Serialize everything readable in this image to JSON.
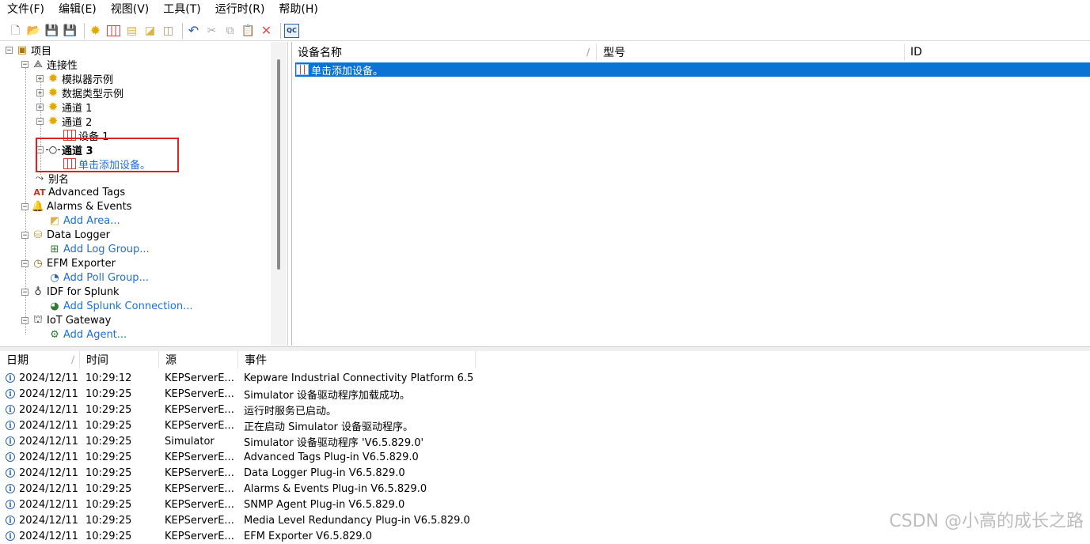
{
  "menu": [
    "文件(F)",
    "编辑(E)",
    "视图(V)",
    "工具(T)",
    "运行时(R)",
    "帮助(H)"
  ],
  "toolbar": {
    "icons": [
      "new-icon",
      "open-icon",
      "save-icon",
      "save-as-icon",
      "new-channel-icon",
      "new-device-icon",
      "new-group-icon",
      "new-tag-icon",
      "bulk-tag-icon",
      "undo-icon",
      "cut-icon",
      "copy-icon",
      "paste-icon",
      "delete-icon",
      "quick-client-icon"
    ],
    "qc_label": "QC"
  },
  "tree": {
    "project": "项目",
    "connectivity": "连接性",
    "sim_example": "模拟器示例",
    "datatype_example": "数据类型示例",
    "channel1": "通道 1",
    "channel2": "通道 2",
    "device1": "设备 1",
    "channel3": "通道 3",
    "add_device": "单击添加设备。",
    "alias": "别名",
    "advanced_tags": "Advanced Tags",
    "alarms_events": "Alarms & Events",
    "add_area": "Add Area...",
    "data_logger": "Data Logger",
    "add_log_group": "Add Log Group...",
    "efm_exporter": "EFM Exporter",
    "add_poll_group": "Add Poll Group...",
    "idf_splunk": "IDF for Splunk",
    "add_splunk": "Add Splunk Connection...",
    "iot_gateway": "IoT Gateway",
    "add_agent": "Add Agent..."
  },
  "devices": {
    "headers": [
      "设备名称",
      "型号",
      "ID"
    ],
    "selected_row": "单击添加设备。"
  },
  "log": {
    "headers": [
      "日期",
      "时间",
      "源",
      "事件"
    ],
    "rows": [
      {
        "date": "2024/12/11",
        "time": "10:29:12",
        "source": "KEPServerE...",
        "event": "Kepware Industrial Connectivity Platform 6.5"
      },
      {
        "date": "2024/12/11",
        "time": "10:29:25",
        "source": "KEPServerE...",
        "event": "Simulator 设备驱动程序加载成功。"
      },
      {
        "date": "2024/12/11",
        "time": "10:29:25",
        "source": "KEPServerE...",
        "event": "运行时服务已启动。"
      },
      {
        "date": "2024/12/11",
        "time": "10:29:25",
        "source": "KEPServerE...",
        "event": "正在启动 Simulator 设备驱动程序。"
      },
      {
        "date": "2024/12/11",
        "time": "10:29:25",
        "source": "Simulator",
        "event": "Simulator 设备驱动程序 'V6.5.829.0'"
      },
      {
        "date": "2024/12/11",
        "time": "10:29:25",
        "source": "KEPServerE...",
        "event": "Advanced Tags Plug-in V6.5.829.0"
      },
      {
        "date": "2024/12/11",
        "time": "10:29:25",
        "source": "KEPServerE...",
        "event": "Data Logger Plug-in V6.5.829.0"
      },
      {
        "date": "2024/12/11",
        "time": "10:29:25",
        "source": "KEPServerE...",
        "event": "Alarms & Events Plug-in V6.5.829.0"
      },
      {
        "date": "2024/12/11",
        "time": "10:29:25",
        "source": "KEPServerE...",
        "event": "SNMP Agent Plug-in V6.5.829.0"
      },
      {
        "date": "2024/12/11",
        "time": "10:29:25",
        "source": "KEPServerE...",
        "event": "Media Level Redundancy Plug-in V6.5.829.0"
      },
      {
        "date": "2024/12/11",
        "time": "10:29:25",
        "source": "KEPServerE...",
        "event": "EFM Exporter V6.5.829.0"
      }
    ]
  },
  "watermark": "CSDN @小高的成长之路",
  "colors": {
    "selection": "#0a74d4",
    "link": "#1e6fd9",
    "highlight_box": "#e02020"
  }
}
